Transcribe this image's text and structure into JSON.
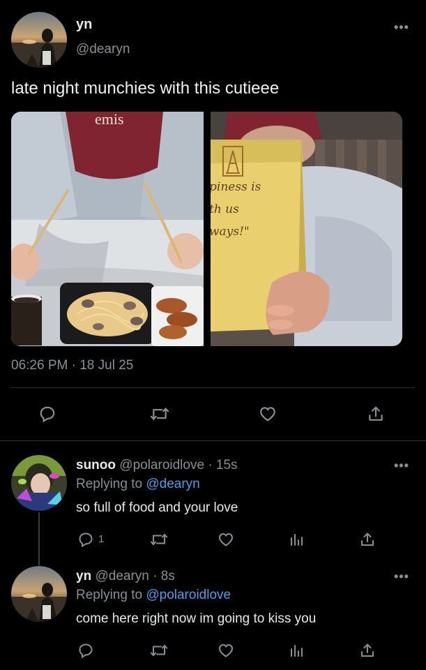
{
  "main_post": {
    "name": "yn",
    "handle": "@dearyn",
    "more": "•••",
    "text": "late night munchies with this cutieee",
    "timestamp": "06:26 PM · 18 Jul 25",
    "photos": {
      "left_cap_text": "emis",
      "right_bag_text": [
        "piness is",
        "th us",
        "ways!\""
      ]
    },
    "icons": [
      "reply-icon",
      "retweet-icon",
      "like-icon",
      "share-icon"
    ]
  },
  "replies": [
    {
      "name": "sunoo",
      "handle": "@polaroidlove",
      "time": "· 15s",
      "replying_label": "Replying to",
      "replying_to": "@dearyn",
      "text": "so full of food and your love",
      "reply_count": "1",
      "more": "•••"
    },
    {
      "name": "yn",
      "handle": "@dearyn",
      "time": "· 8s",
      "replying_label": "Replying to",
      "replying_to": "@polaroidlove",
      "text": "come here right now im going to kiss you",
      "more": "•••"
    }
  ],
  "colors": {
    "background": "#000000",
    "text": "#e7e9ea",
    "muted": "#8b8f94",
    "link": "#4e9ded",
    "divider": "#2f3336"
  }
}
